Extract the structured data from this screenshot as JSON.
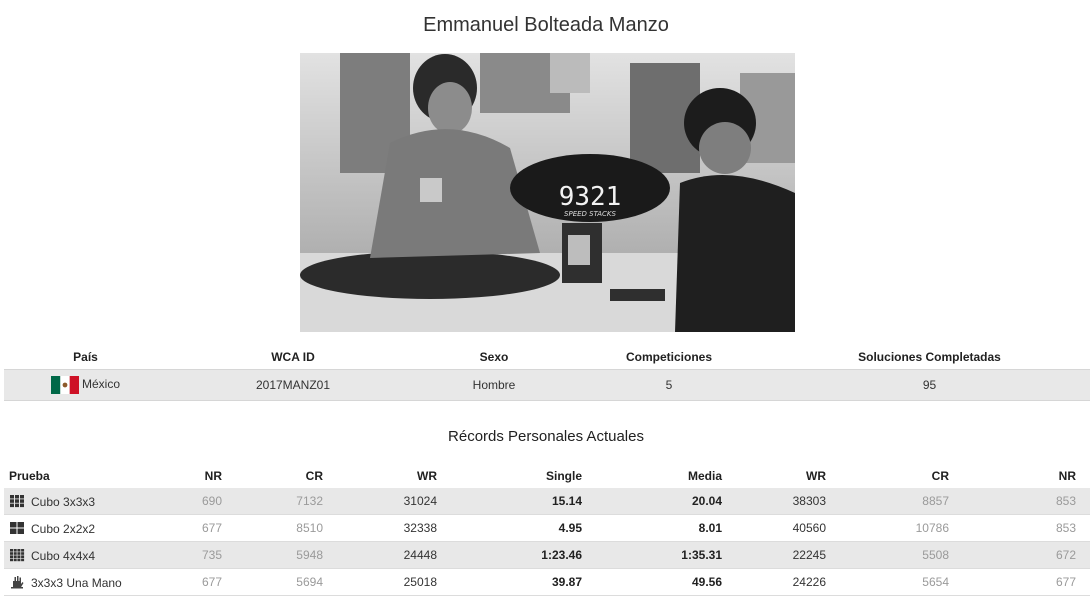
{
  "profile": {
    "name": "Emmanuel Bolteada Manzo",
    "headers": {
      "country": "País",
      "wca_id": "WCA ID",
      "gender": "Sexo",
      "competitions": "Competiciones",
      "completed_solves": "Soluciones Completadas"
    },
    "values": {
      "country": "México",
      "country_flag": "mexico-flag-icon",
      "wca_id": "2017MANZ01",
      "gender": "Hombre",
      "competitions": "5",
      "completed_solves": "95"
    },
    "photo_timer_display": "9321",
    "photo_timer_brand": "SPEED STACKS"
  },
  "records": {
    "title": "Récords Personales Actuales",
    "headers": {
      "event": "Prueba",
      "single_nr": "NR",
      "single_cr": "CR",
      "single_wr": "WR",
      "single": "Single",
      "average": "Media",
      "average_wr": "WR",
      "average_cr": "CR",
      "average_nr": "NR"
    },
    "rows": [
      {
        "icon": "cube-3x3-icon",
        "event": "Cubo 3x3x3",
        "single_nr": "690",
        "single_cr": "7132",
        "single_wr": "31024",
        "single": "15.14",
        "average": "20.04",
        "average_wr": "38303",
        "average_cr": "8857",
        "average_nr": "853"
      },
      {
        "icon": "cube-2x2-icon",
        "event": "Cubo 2x2x2",
        "single_nr": "677",
        "single_cr": "8510",
        "single_wr": "32338",
        "single": "4.95",
        "average": "8.01",
        "average_wr": "40560",
        "average_cr": "10786",
        "average_nr": "853"
      },
      {
        "icon": "cube-4x4-icon",
        "event": "Cubo 4x4x4",
        "single_nr": "735",
        "single_cr": "5948",
        "single_wr": "24448",
        "single": "1:23.46",
        "average": "1:35.31",
        "average_wr": "22245",
        "average_cr": "5508",
        "average_nr": "672"
      },
      {
        "icon": "one-hand-icon",
        "event": "3x3x3 Una Mano",
        "single_nr": "677",
        "single_cr": "5694",
        "single_wr": "25018",
        "single": "39.87",
        "average": "49.56",
        "average_wr": "24226",
        "average_cr": "5654",
        "average_nr": "677"
      }
    ]
  }
}
